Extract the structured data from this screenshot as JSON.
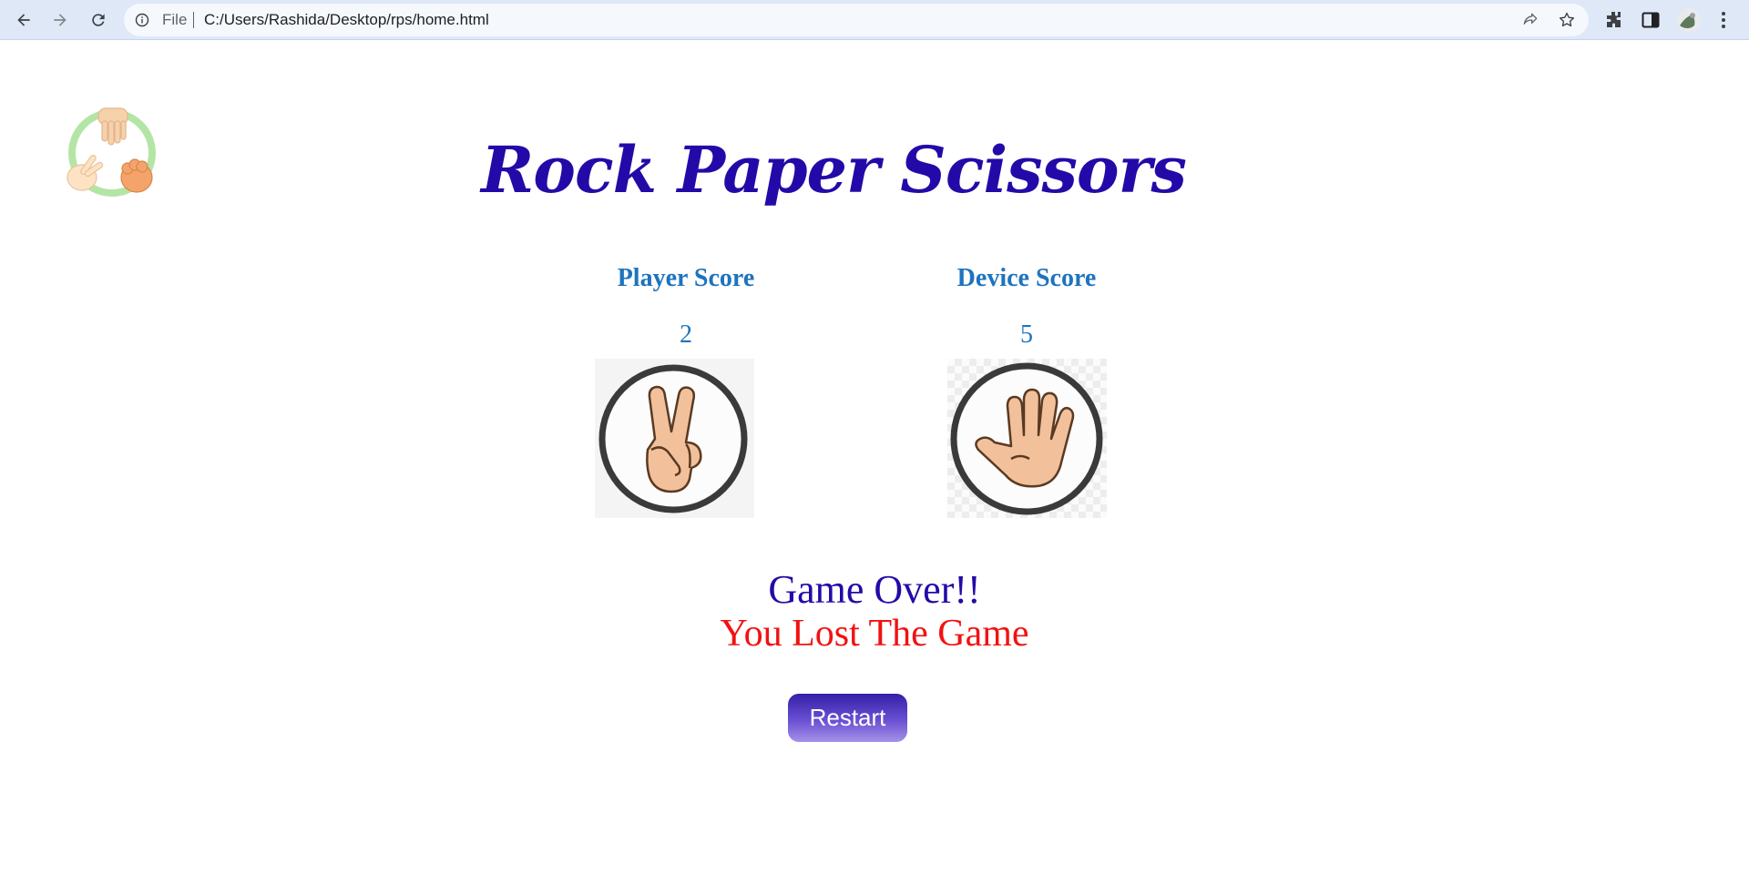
{
  "browser": {
    "scheme_label": "File",
    "url": "C:/Users/Rashida/Desktop/rps/home.html"
  },
  "page": {
    "title": "Rock Paper Scissors",
    "player": {
      "label": "Player Score",
      "score": "2",
      "choice_icon": "scissors-hand-icon"
    },
    "device": {
      "label": "Device Score",
      "score": "5",
      "choice_icon": "paper-hand-icon"
    },
    "status": "Game Over!!",
    "result": "You Lost The Game",
    "restart_label": "Restart"
  },
  "colors": {
    "title": "#230aa8",
    "score": "#1e73be",
    "status": "#230aa8",
    "result": "#f21111",
    "restart_bg": "#4b2fc0"
  }
}
